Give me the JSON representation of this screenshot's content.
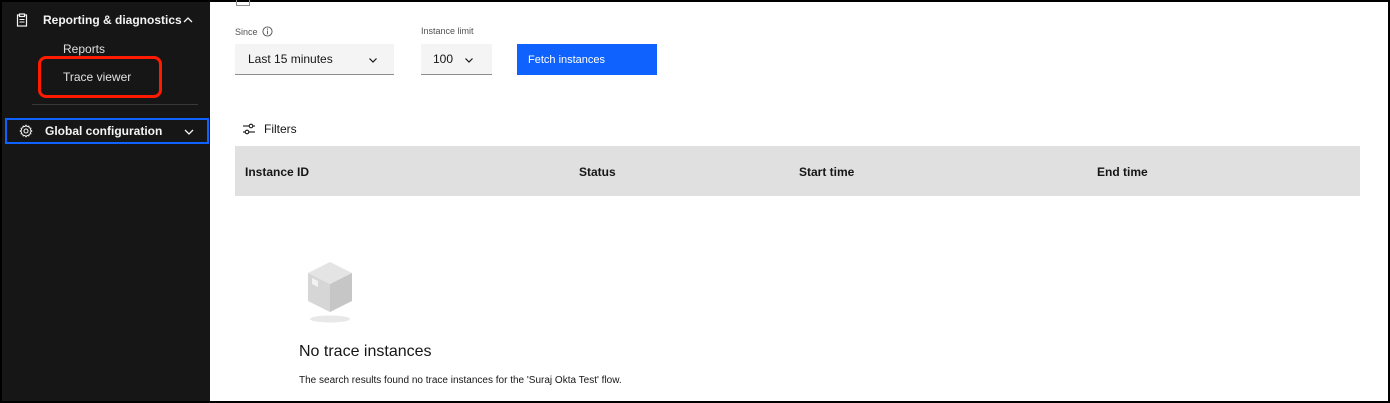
{
  "sidebar": {
    "groups": [
      {
        "label": "Reporting & diagnostics",
        "icon": "clipboard-icon",
        "expanded": true,
        "items": [
          {
            "label": "Reports"
          },
          {
            "label": "Trace viewer"
          }
        ]
      },
      {
        "label": "Global configuration",
        "icon": "gear-icon",
        "expanded": false
      }
    ]
  },
  "controls": {
    "since": {
      "label": "Since",
      "value": "Last 15 minutes"
    },
    "limit": {
      "label": "Instance limit",
      "value": "100"
    },
    "fetch_label": "Fetch instances"
  },
  "filters_label": "Filters",
  "table": {
    "columns": [
      "Instance ID",
      "Status",
      "Start time",
      "End time"
    ]
  },
  "empty_state": {
    "title": "No trace instances",
    "description": "The search results found no trace instances for the 'Suraj Okta Test' flow."
  },
  "colors": {
    "sidebar_bg": "#161616",
    "accent": "#0f62fe",
    "highlight": "#ff1a00",
    "table_header_bg": "#e0e0e0"
  }
}
